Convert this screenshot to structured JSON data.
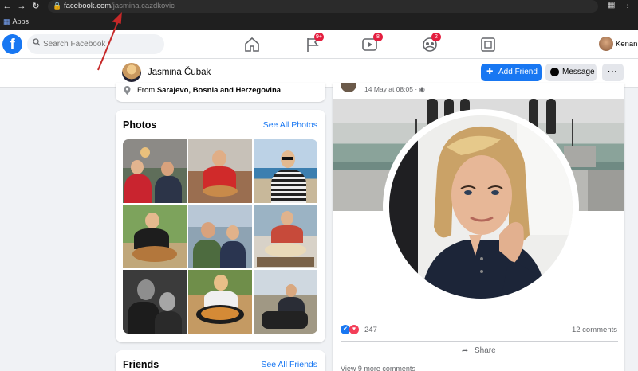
{
  "browser": {
    "url_host": "facebook.com",
    "url_path": "/jasmina.cazdkovic",
    "bookmarks_apps_label": "Apps",
    "nav_icons": [
      "back-icon",
      "forward-icon",
      "reload-icon"
    ],
    "extension_icons": [
      "translate-icon",
      "menu-icon"
    ]
  },
  "fb_header": {
    "logo": "f",
    "search_placeholder": "Search Facebook",
    "nav_items": [
      {
        "name": "home",
        "icon": "home-icon",
        "badge": ""
      },
      {
        "name": "pages",
        "icon": "flag-icon",
        "badge": "9+"
      },
      {
        "name": "watch",
        "icon": "video-icon",
        "badge": "8"
      },
      {
        "name": "groups",
        "icon": "groups-icon",
        "badge": "2"
      },
      {
        "name": "gaming",
        "icon": "gaming-icon",
        "badge": ""
      }
    ],
    "user_name": "Kenan"
  },
  "profile_header": {
    "name": "Jasmina Čubak",
    "add_friend_label": "Add Friend",
    "message_label": "Message",
    "more_label": "···"
  },
  "intro": {
    "from_prefix": "From",
    "from_place": "Sarajevo, Bosnia and Herzegovina"
  },
  "photos": {
    "title": "Photos",
    "see_all": "See All Photos",
    "count": 9
  },
  "friends": {
    "title": "Friends",
    "see_all": "See All Friends"
  },
  "post": {
    "date": "14 May at 08:05 · ",
    "reaction_count": "247",
    "comments": "12 comments",
    "share_label": "Share",
    "more_comments": "View 9 more comments"
  },
  "colors": {
    "facebook_blue": "#1877f2",
    "badge_red": "#e41e3f",
    "annotation_red": "#c62828"
  }
}
